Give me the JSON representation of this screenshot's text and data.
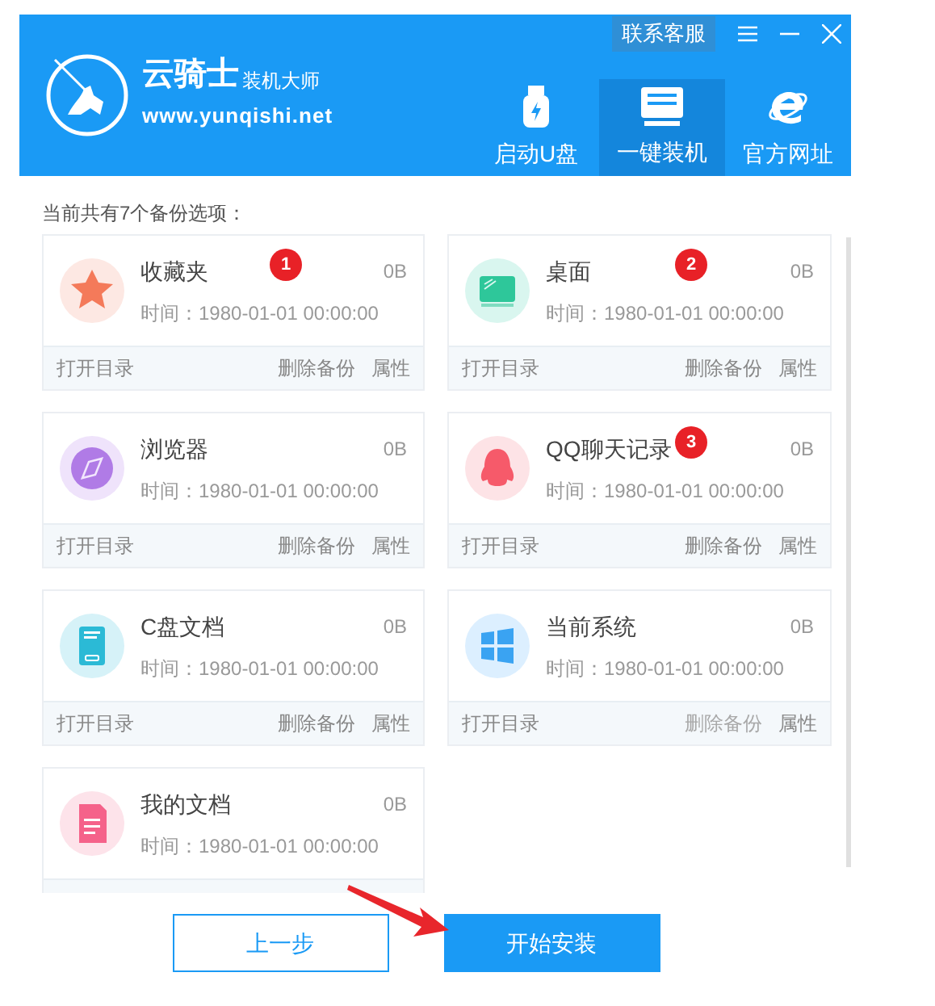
{
  "header": {
    "logo_title": "云骑士",
    "logo_subtitle": "装机大师",
    "logo_url": "www.yunqishi.net",
    "support_button": "联系客服",
    "nav": [
      {
        "label": "启动U盘",
        "kind": "usb",
        "selected": false
      },
      {
        "label": "一键装机",
        "kind": "install",
        "selected": true
      },
      {
        "label": "官方网址",
        "kind": "web",
        "selected": false
      }
    ]
  },
  "summary": "当前共有7个备份选项：",
  "backups": [
    {
      "kind": "favorites",
      "name": "收藏夹",
      "size": "0B",
      "time": "时间：1980-01-01 00:00:00",
      "marker": "1",
      "actions": [
        {
          "label": "打开目录",
          "disabled": false
        },
        {
          "label": "删除备份",
          "disabled": false
        },
        {
          "label": "属性",
          "disabled": false
        }
      ]
    },
    {
      "kind": "desktop",
      "name": "桌面",
      "size": "0B",
      "time": "时间：1980-01-01 00:00:00",
      "marker": "2",
      "actions": [
        {
          "label": "打开目录",
          "disabled": false
        },
        {
          "label": "删除备份",
          "disabled": false
        },
        {
          "label": "属性",
          "disabled": false
        }
      ]
    },
    {
      "kind": "browser",
      "name": "浏览器",
      "size": "0B",
      "time": "时间：1980-01-01 00:00:00",
      "actions": [
        {
          "label": "打开目录",
          "disabled": false
        },
        {
          "label": "删除备份",
          "disabled": false
        },
        {
          "label": "属性",
          "disabled": false
        }
      ]
    },
    {
      "kind": "qq",
      "name": "QQ聊天记录",
      "size": "0B",
      "time": "时间：1980-01-01 00:00:00",
      "marker": "3",
      "actions": [
        {
          "label": "打开目录",
          "disabled": false
        },
        {
          "label": "删除备份",
          "disabled": false
        },
        {
          "label": "属性",
          "disabled": false
        }
      ]
    },
    {
      "kind": "c-drive",
      "name": "C盘文档",
      "size": "0B",
      "time": "时间：1980-01-01 00:00:00",
      "actions": [
        {
          "label": "打开目录",
          "disabled": false
        },
        {
          "label": "删除备份",
          "disabled": false
        },
        {
          "label": "属性",
          "disabled": false
        }
      ]
    },
    {
      "kind": "system",
      "name": "当前系统",
      "size": "0B",
      "time": "时间：1980-01-01 00:00:00",
      "actions": [
        {
          "label": "打开目录",
          "disabled": false
        },
        {
          "label": "删除备份",
          "disabled": true
        },
        {
          "label": "属性",
          "disabled": false
        }
      ]
    },
    {
      "kind": "documents",
      "name": "我的文档",
      "size": "0B",
      "time": "时间：1980-01-01 00:00:00"
    }
  ],
  "buttons": [
    {
      "label": "上一步",
      "kind": "secondary"
    },
    {
      "label": "开始安装",
      "kind": "primary"
    }
  ]
}
